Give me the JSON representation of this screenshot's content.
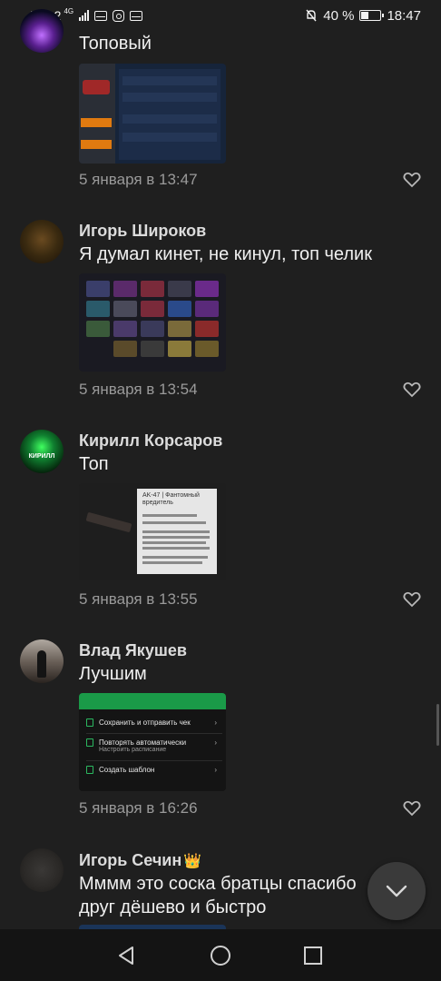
{
  "status_bar": {
    "carrier": "Tele2",
    "network": "4G",
    "battery_percent": "40 %",
    "battery_level": 0.4,
    "time": "18:47"
  },
  "comments": [
    {
      "text": "Топовый",
      "date": "5 января в 13:47",
      "avatar": "galaxy-avatar",
      "attachment": "inventory-trade-screenshot"
    },
    {
      "author": "Игорь Широков",
      "text": "Я думал кинет, не кинул, топ челик",
      "date": "5 января в 13:54",
      "avatar": "game-logo-avatar",
      "attachment": "skins-grid-screenshot"
    },
    {
      "author": "Кирилл Корсаров",
      "text": "Топ",
      "avatar_text": "КИРИЛЛ",
      "date": "5 января в 13:55",
      "avatar": "green-logo-avatar",
      "attachment": "ak47-item-screenshot",
      "attachment_title": "AK-47 | Фантомный вредитель"
    },
    {
      "author": "Влад Якушев",
      "text": "Лучшим",
      "date": "5 января в 16:26",
      "avatar": "person-photo-avatar",
      "attachment": "bank-app-menu-screenshot",
      "attachment_items": [
        {
          "label": "Сохранить и отправить чек"
        },
        {
          "label": "Повторять автоматически",
          "sub": "Настроить расписание"
        },
        {
          "label": "Создать шаблон"
        }
      ]
    },
    {
      "author": "Игорь Сечин",
      "author_emoji": "👑",
      "text_line1": "Мммм это соска братцы спасибо",
      "text_line2": "друг дёшево и быстро",
      "avatar": "dark-logo-avatar"
    }
  ],
  "icons": {
    "like": "heart-outline-icon",
    "scroll_down": "chevron-down-icon",
    "nav_back": "triangle-back-icon",
    "nav_home": "circle-home-icon",
    "nav_recents": "square-recents-icon"
  },
  "colors": {
    "background": "#1f1f1f",
    "text_primary": "#f0f0f0",
    "text_secondary": "#9a9a9a",
    "navbar": "#141414"
  }
}
